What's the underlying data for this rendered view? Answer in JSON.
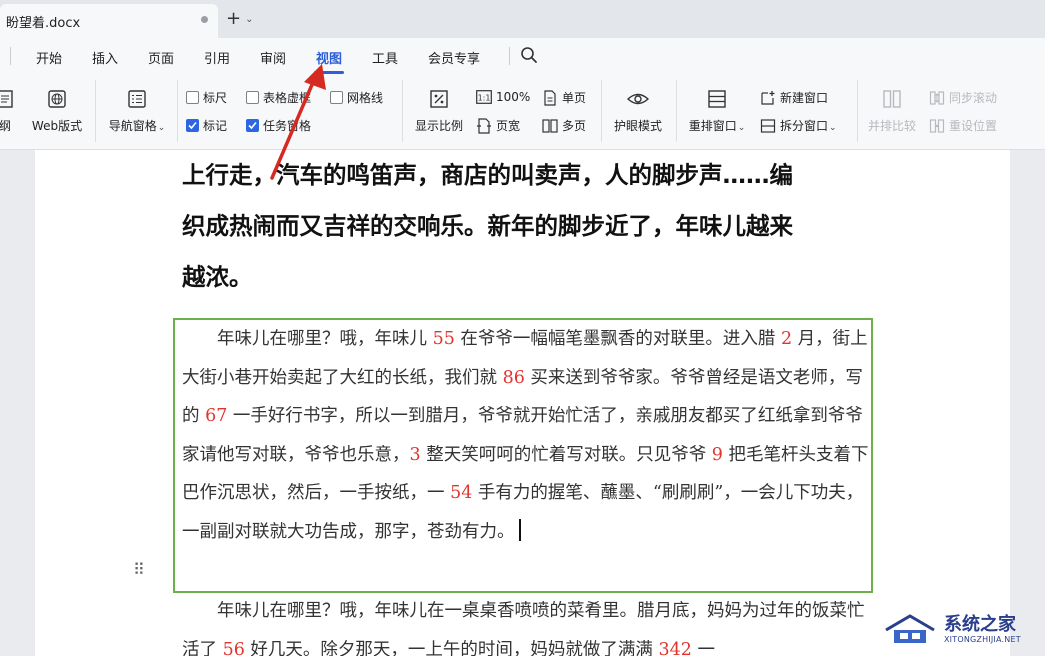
{
  "titlebar": {
    "doc_tab_label": "盼望着.docx"
  },
  "menubar": {
    "items": [
      {
        "label": "开始"
      },
      {
        "label": "插入"
      },
      {
        "label": "页面"
      },
      {
        "label": "引用"
      },
      {
        "label": "审阅"
      },
      {
        "label": "视图",
        "active": true
      },
      {
        "label": "工具"
      },
      {
        "label": "会员专享"
      }
    ]
  },
  "ribbon": {
    "outline_label": "纲",
    "web_layout_label": "Web版式",
    "nav_pane_label": "导航窗格",
    "ruler_label": "标尺",
    "table_grid_label": "表格虚框",
    "gridlines_label": "网格线",
    "marks_label": "标记",
    "task_pane_label": "任务窗格",
    "display_ratio_label": "显示比例",
    "zoom_100_label": "100%",
    "page_width_label": "页宽",
    "single_page_label": "单页",
    "multi_page_label": "多页",
    "eye_mode_label": "护眼模式",
    "rearrange_label": "重排窗口",
    "new_window_label": "新建窗口",
    "split_window_label": "拆分窗口",
    "side_by_side_label": "并排比较",
    "sync_scroll_label": "同步滚动",
    "reset_position_label": "重设位置",
    "checkbox_ruler": false,
    "checkbox_table_grid": false,
    "checkbox_gridlines": false,
    "checkbox_marks": true,
    "checkbox_task_pane": true
  },
  "document": {
    "heading_line1": "上行走，汽车的鸣笛声，商店的叫卖声，人的脚步声……编",
    "heading_line2": "织成热闹而又吉祥的交响乐。新年的脚步近了，年味儿越来",
    "heading_line3": "越浓。",
    "p1": {
      "s1": "　　年味儿在哪里？哦，年味儿 ",
      "n1": "55",
      "s2": " 在爷爷一幅幅笔墨飘香的对联里。进入腊 ",
      "n2": "2",
      "s3": " 月，街上大街小巷开始卖起了大红的长纸，我们就 ",
      "n3": "86",
      "s4": " 买来送到爷爷家。爷爷曾经是语文老师，写的 ",
      "n4": "67",
      "s5": " 一手好行书字，所以一到腊月，爷爷就开始忙活了，亲戚朋友都买了红纸拿到爷爷家请他写对联，爷爷也乐意，",
      "n5": "3",
      "s6": " 整天笑呵呵的忙着写对联。只见爷爷 ",
      "n6": "9",
      "s7": " 把毛笔杆头支着下巴作沉思状，然后，一手按纸，一 ",
      "n7": "54",
      "s8": " 手有力的握笔、蘸墨、“刷刷刷”，一会儿下功夫，一副副对联就大功告成，那字，苍劲有力。"
    },
    "p2": {
      "s1": "　　年味儿在哪里？哦，年味儿在一桌桌香喷喷的菜肴里。腊月底，妈妈为过年的饭菜忙活了 ",
      "n1": "56",
      "s2": " 好几天。除夕那天，一上午的时间，妈妈就做了满满 ",
      "n2": "342",
      "s3": " 一"
    }
  },
  "watermark": {
    "title": "系统之家",
    "url": "XITONGZHIJIA.NET"
  },
  "colors": {
    "accent": "#2c5fd8",
    "number_red": "#e0342d",
    "selection_border": "#6cb04b",
    "arrow_red": "#d42a22"
  }
}
